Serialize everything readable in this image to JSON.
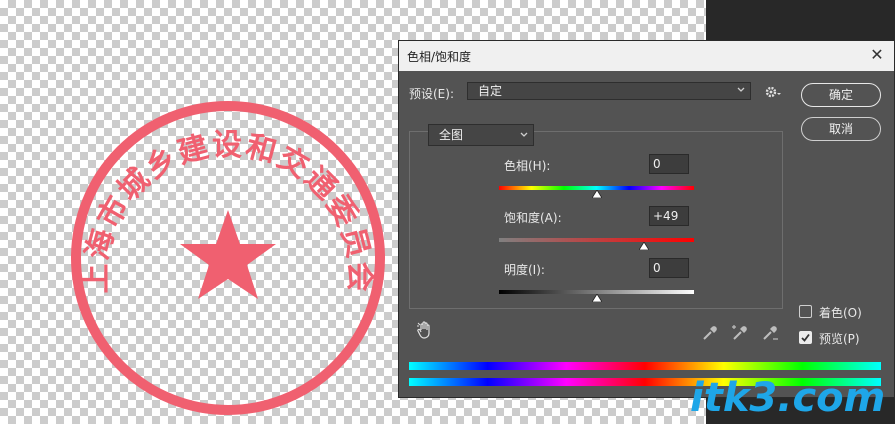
{
  "dialog": {
    "title": "色相/饱和度",
    "preset_label": "预设(E):",
    "preset_value": "自定",
    "ok_label": "确定",
    "cancel_label": "取消",
    "channel_value": "全图",
    "hue": {
      "label": "色相(H):",
      "value": "0",
      "position": 0.5
    },
    "saturation": {
      "label": "饱和度(A):",
      "value": "+49",
      "position": 0.745
    },
    "lightness": {
      "label": "明度(I):",
      "value": "0",
      "position": 0.5
    },
    "colorize_label": "着色(O)",
    "colorize_checked": false,
    "preview_label": "预览(P)",
    "preview_checked": true
  },
  "seal": {
    "text": "上海市城乡建设和交通委员会"
  },
  "watermark": {
    "text": "itk3.com"
  },
  "colors": {
    "dialog_bg": "#535353",
    "seal_red": "#f06070",
    "watermark_blue": "#1ea6e8"
  },
  "icons": [
    "close-icon",
    "chevron-down-icon",
    "gear-icon",
    "hand-icon",
    "eyedropper-icon",
    "eyedropper-plus-icon",
    "eyedropper-minus-icon",
    "check-icon",
    "star-icon"
  ]
}
